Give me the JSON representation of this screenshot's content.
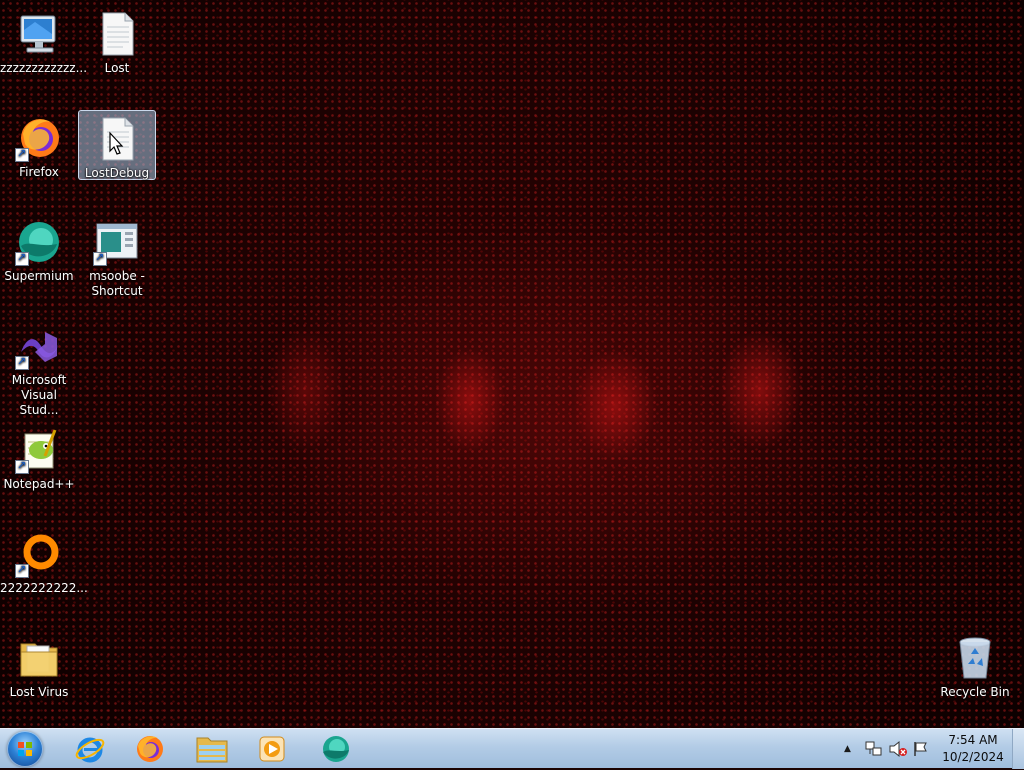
{
  "desktop": {
    "icons": [
      {
        "label": "zzzzzzzzzzzz...",
        "icon": "computer-icon"
      },
      {
        "label": "Lost",
        "icon": "text-file-icon"
      },
      {
        "label": "Firefox",
        "icon": "firefox-icon"
      },
      {
        "label": "LostDebug",
        "icon": "text-file-icon",
        "selected": true
      },
      {
        "label": "Supermium",
        "icon": "supermium-icon"
      },
      {
        "label": "msoobe -\nShortcut",
        "label_line1": "msoobe -",
        "label_line2": "Shortcut",
        "icon": "window-app-icon"
      },
      {
        "label_line1": "Microsoft",
        "label_line2": "Visual Stud...",
        "icon": "visual-studio-icon"
      },
      {
        "label": "Notepad++",
        "icon": "notepad-plus-plus-icon"
      },
      {
        "label": "2222222222...",
        "icon": "orange-ring-icon"
      },
      {
        "label": "Lost Virus",
        "icon": "folder-icon"
      },
      {
        "label": "Recycle Bin",
        "icon": "recycle-bin-icon"
      }
    ]
  },
  "taskbar": {
    "pinned": [
      {
        "name": "internet-explorer",
        "icon": "internet-explorer-icon"
      },
      {
        "name": "firefox",
        "icon": "firefox-icon"
      },
      {
        "name": "file-explorer",
        "icon": "folder-icon"
      },
      {
        "name": "media-player",
        "icon": "media-player-icon"
      },
      {
        "name": "supermium",
        "icon": "supermium-icon"
      }
    ],
    "clock": {
      "time": "7:54 AM",
      "date": "10/2/2024"
    }
  },
  "colors": {
    "wallpaper": "#1a0202",
    "wallpaper_glow": "#c81414",
    "taskbar": "#b3cce6",
    "selection": "#aac8e6"
  }
}
